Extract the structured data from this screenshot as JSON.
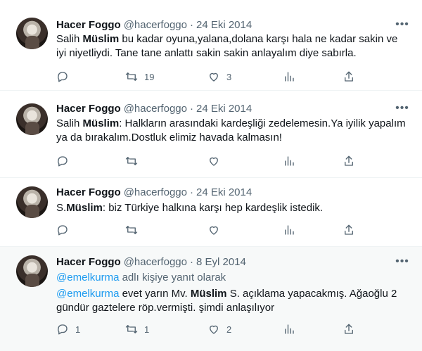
{
  "tweets": [
    {
      "name": "Hacer Foggo",
      "handle": "@hacerfoggo",
      "sep": "·",
      "date": "24 Eki 2014",
      "text_pre": "Salih ",
      "text_bold": "Müslim",
      "text_post": " bu kadar oyuna,yalana,dolana karşı hala ne kadar sakin ve iyi niyetliydi. Tane tane anlattı sakin sakin anlayalım diye sabırla.",
      "reply": "",
      "retweets": "19",
      "likes": "3"
    },
    {
      "name": "Hacer Foggo",
      "handle": "@hacerfoggo",
      "sep": "·",
      "date": "24 Eki 2014",
      "text_pre": "Salih ",
      "text_bold": "Müslim",
      "text_post": ": Halkların arasındaki kardeşliği zedelemesin.Ya iyilik yapalım ya da bırakalım.Dostluk elimiz havada kalmasın!",
      "reply": "",
      "retweets": "",
      "likes": ""
    },
    {
      "name": "Hacer Foggo",
      "handle": "@hacerfoggo",
      "sep": "·",
      "date": "24 Eki 2014",
      "text_pre": "S.",
      "text_bold": "Müslim",
      "text_post": ": biz Türkiye halkına karşı hep kardeşlik istedik.",
      "reply": "",
      "retweets": "",
      "likes": ""
    },
    {
      "name": "Hacer Foggo",
      "handle": "@hacerfoggo",
      "sep": "·",
      "date": "8 Eyl 2014",
      "reply_mention": "@emelkurma",
      "reply_suffix": " adlı kişiye yanıt olarak",
      "mention": "@emelkurma",
      "text_pre": " evet yarın Mv. ",
      "text_bold": "Müslim",
      "text_post": " S. açıklama yapacakmış. Ağaoğlu 2 gündür gaztelere röp.vermişti. şimdi anlaşılıyor",
      "replies": "1",
      "retweets": "1",
      "likes": "2"
    }
  ],
  "icons": {
    "more": "more-dots-icon",
    "reply": "reply-icon",
    "retweet": "retweet-icon",
    "like": "heart-icon",
    "views": "views-icon",
    "share": "share-icon"
  },
  "colors": {
    "link": "#1d9bf0",
    "secondary": "#536471",
    "text": "#0f1419"
  }
}
